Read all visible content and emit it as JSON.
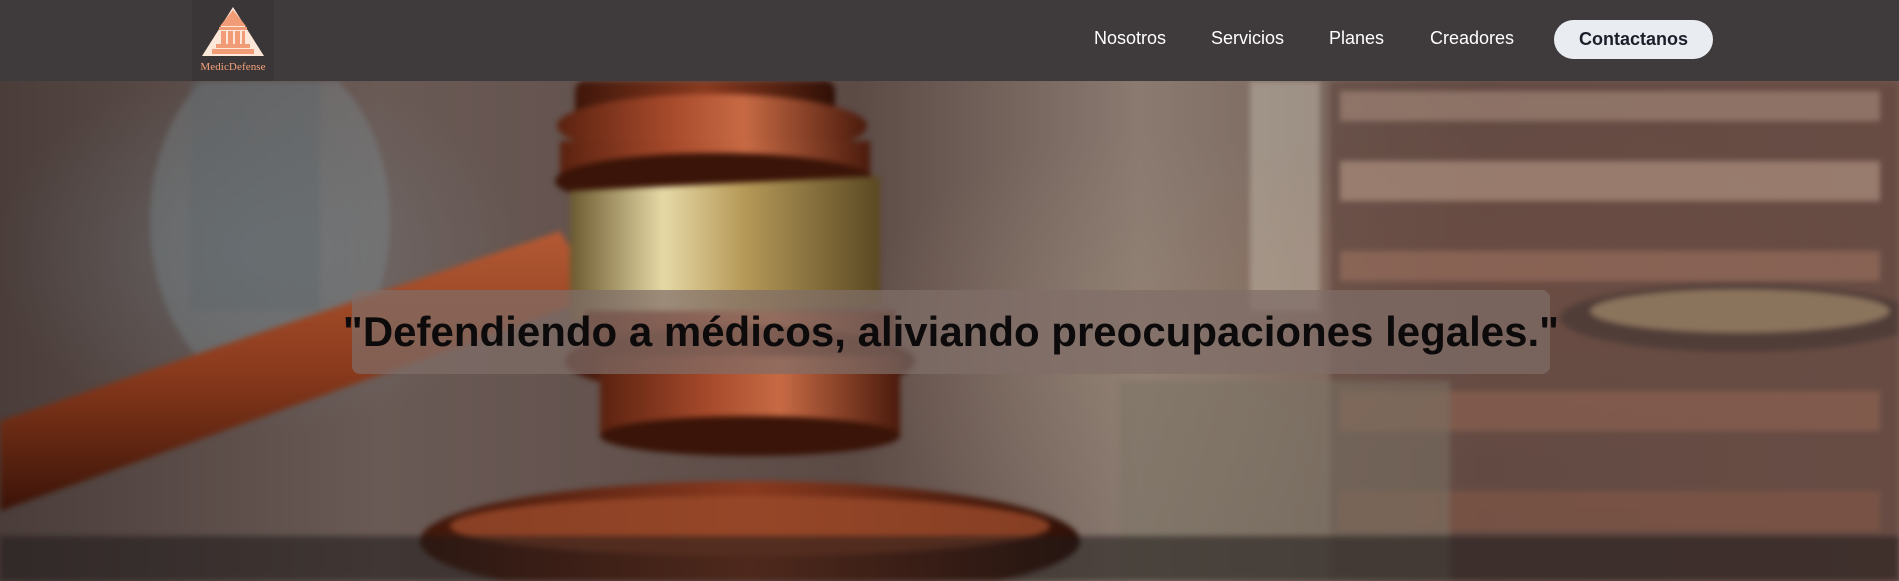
{
  "header": {
    "logo": {
      "icon": "courthouse-icon",
      "text": "MedicDefense"
    },
    "nav": [
      {
        "label": "Nosotros"
      },
      {
        "label": "Servicios"
      },
      {
        "label": "Planes"
      },
      {
        "label": "Creadores"
      }
    ],
    "contact_label": "Contactanos"
  },
  "hero": {
    "background_image": "gavel-and-scales-of-justice",
    "quote": "\"Defendiendo a médicos, aliviando preocupaciones legales.\""
  },
  "colors": {
    "header_bg": "#3f3a3b",
    "logo_accent": "#f6a37c",
    "button_bg": "#e9edf2",
    "button_text": "#1c1f2a"
  }
}
